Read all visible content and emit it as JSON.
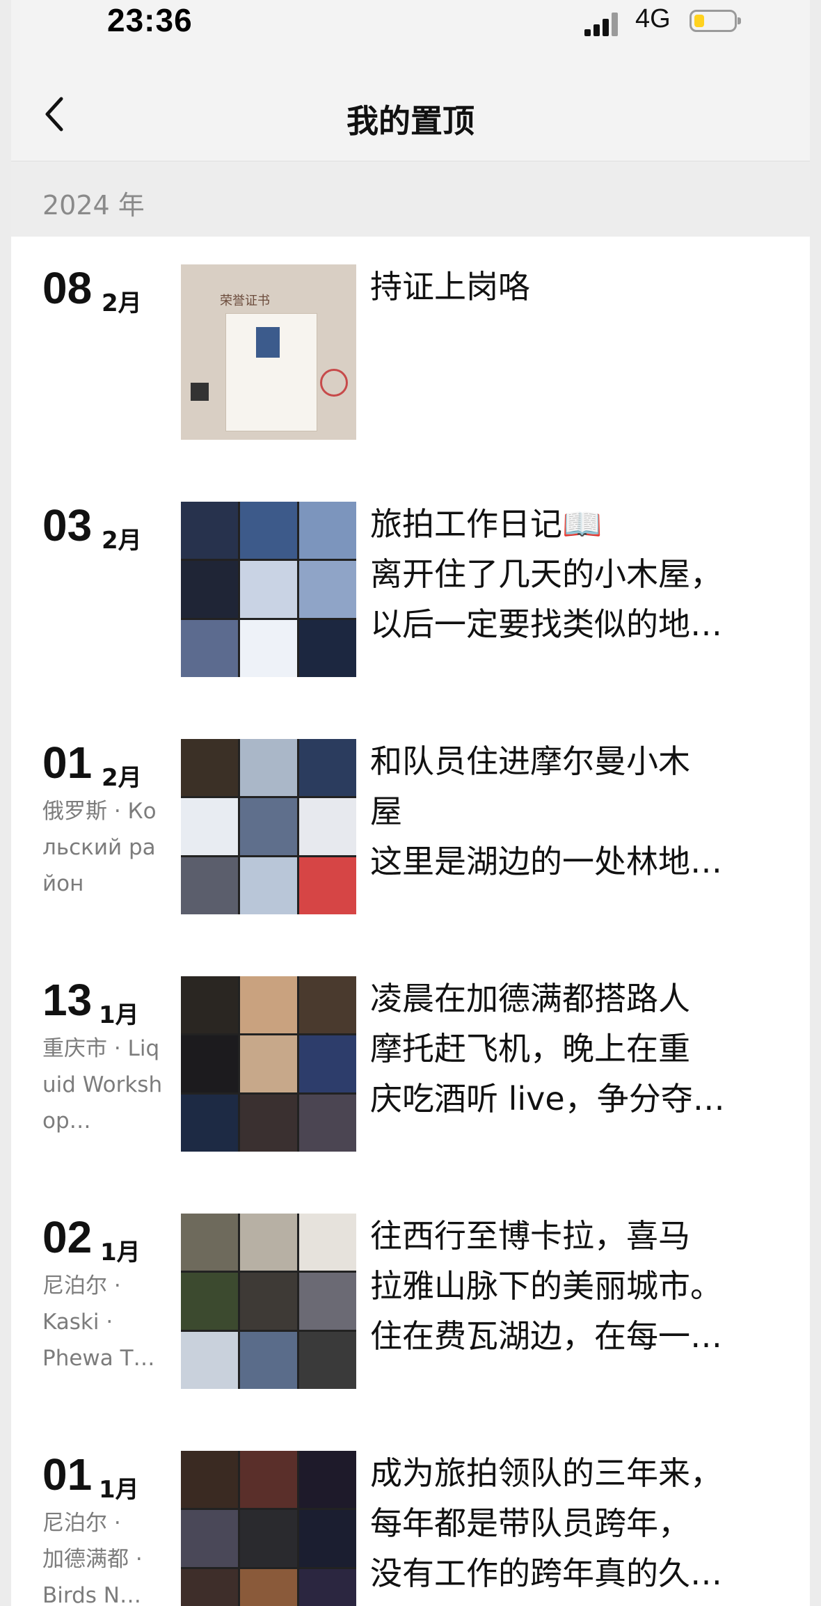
{
  "status_bar": {
    "time": "23:36",
    "network": "4G"
  },
  "nav": {
    "title": "我的置顶",
    "back_icon": "chevron-left-icon"
  },
  "year_header": "2024 年",
  "posts": [
    {
      "day": "08",
      "month": "2月",
      "location": "",
      "text": "持证上岗咯",
      "thumb": "certificate"
    },
    {
      "day": "03",
      "month": "2月",
      "location": "",
      "text": "旅拍工作日记📖\n离开住了几天的小木屋，\n以后一定要找类似的地…",
      "thumb": "grid"
    },
    {
      "day": "01",
      "month": "2月",
      "location": "俄罗斯 · Кольский район",
      "text": "和队员住进摩尔曼小木\n屋\n这里是湖边的一处林地…",
      "thumb": "grid"
    },
    {
      "day": "13",
      "month": "1月",
      "location": "重庆市 · Liquid Workshop…",
      "text": "凌晨在加德满都搭路人\n摩托赶飞机，晚上在重\n庆吃酒听 live，争分夺…",
      "thumb": "grid"
    },
    {
      "day": "02",
      "month": "1月",
      "location": "尼泊尔 ·\nKaski ·\nPhewa T…",
      "text": "往西行至博卡拉，喜马\n拉雅山脉下的美丽城市。\n住在费瓦湖边，在每一…",
      "thumb": "grid"
    },
    {
      "day": "01",
      "month": "1月",
      "location": "尼泊尔 ·\n加德满都 ·\nBirds N…",
      "text": "成为旅拍领队的三年来，\n每年都是带队员跨年，\n没有工作的跨年真的久…",
      "thumb": "grid"
    }
  ],
  "colors": {
    "status_bg": "#f3f3f3",
    "year_bg": "#ededed",
    "year_text": "#8a8a8a",
    "location_text": "#7c7c7c",
    "battery_fill": "#ffd21f"
  },
  "photo_palettes": [
    [
      "#27324d",
      "#3d5a8a",
      "#7c95bd",
      "#1f2536",
      "#c9d3e4",
      "#8fa4c7",
      "#5c6b8f",
      "#eef2f8",
      "#1c2740"
    ],
    [
      "#3b3026",
      "#aab7c8",
      "#2b3c5e",
      "#e8ecf2",
      "#5f6f8c",
      "#e7e9ee",
      "#5b5e6c",
      "#b9c6d8",
      "#d64545"
    ],
    [
      "#2a2622",
      "#c9a27f",
      "#4a3a2e",
      "#1c1b1e",
      "#c7a88a",
      "#2d3d6b",
      "#1d2a44",
      "#3a3030",
      "#4b4552"
    ],
    [
      "#6e6a5c",
      "#b7b0a4",
      "#e6e2dc",
      "#3c4a2f",
      "#3e3a36",
      "#6b6a74",
      "#c9d1dc",
      "#5a6c8a",
      "#3a3a3a"
    ],
    [
      "#3a2a22",
      "#5a2f2a",
      "#1e1a2a",
      "#4a4858",
      "#2a2a2e",
      "#1b1e30",
      "#3e2e2a",
      "#8a5a3a",
      "#2b2640"
    ]
  ]
}
